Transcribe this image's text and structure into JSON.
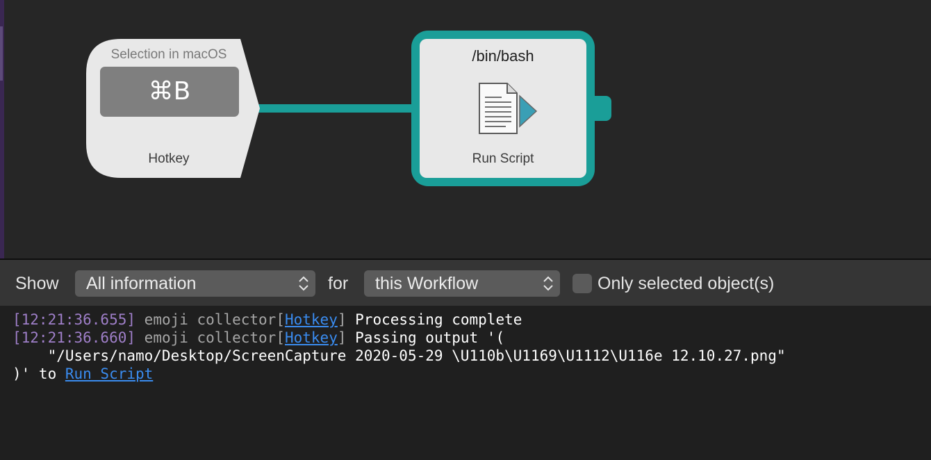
{
  "canvas": {
    "hotkey_node": {
      "caption": "Selection in macOS",
      "combo": "⌘B",
      "label": "Hotkey"
    },
    "script_node": {
      "title": "/bin/bash",
      "icon": "script-document-icon",
      "label": "Run Script"
    },
    "colors": {
      "accent": "#1a9e98",
      "node_bg": "#e8e8e8",
      "canvas_bg": "#262626"
    }
  },
  "debugger": {
    "show_label": "Show",
    "show_select": "All information",
    "for_label": "for",
    "scope_select": "this Workflow",
    "only_selected_label": "Only selected object(s)",
    "only_selected_checked": false,
    "log": [
      {
        "timestamp": "[12:21:36.655]",
        "workflow": "emoji collector",
        "source": "Hotkey",
        "message": "Processing complete"
      },
      {
        "timestamp": "[12:21:36.660]",
        "workflow": "emoji collector",
        "source": "Hotkey",
        "message": "Passing output '(",
        "continuation": "    \"/Users/namo/Desktop/ScreenCapture 2020-05-29 \\U110b\\U1169\\U1112\\U116e 12.10.27.png\"",
        "tail_prefix": ")' to ",
        "tail_link": "Run Script"
      }
    ],
    "colors": {
      "timestamp": "#9f7fc9",
      "link": "#3a8cf0"
    }
  }
}
